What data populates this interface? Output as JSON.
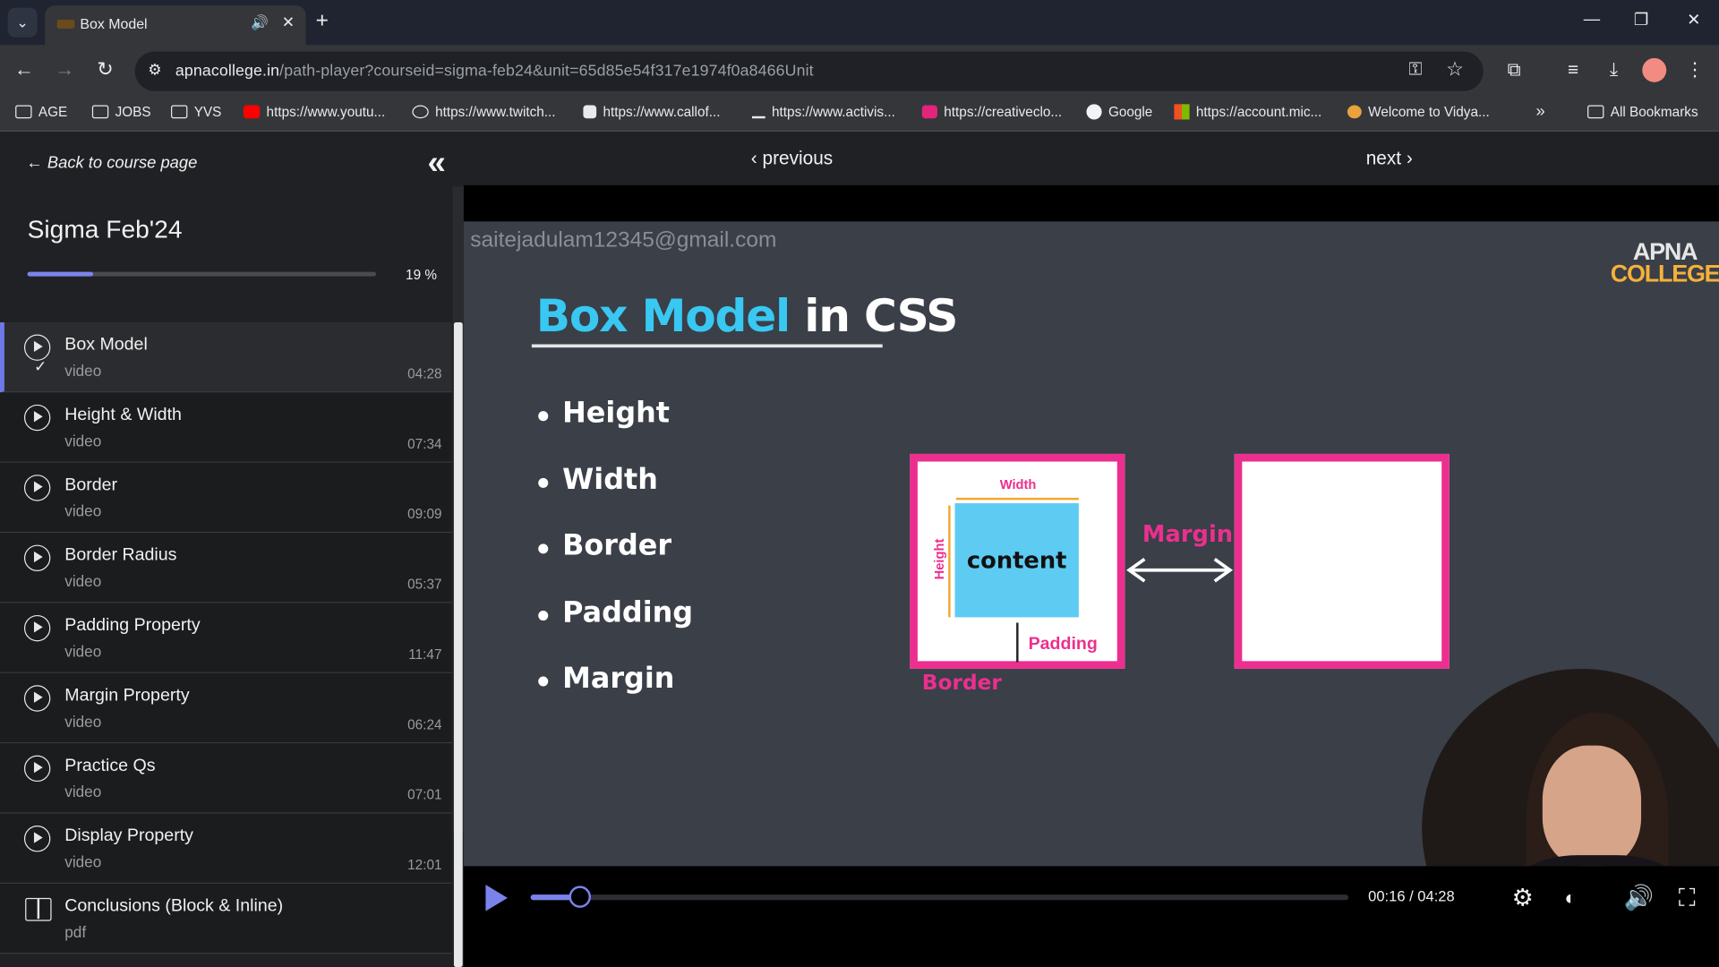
{
  "browser": {
    "tab_title": "Box Model",
    "url_host": "apnacollege.in",
    "url_path": "/path-player?courseid=sigma-feb24&unit=65d85e54f317e1974f0a8466Unit",
    "bookmarks": [
      {
        "label": "AGE",
        "icon": "folder-icon"
      },
      {
        "label": "JOBS",
        "icon": "folder-icon"
      },
      {
        "label": "YVS",
        "icon": "folder-icon"
      },
      {
        "label": "https://www.youtu...",
        "icon": "youtube-icon"
      },
      {
        "label": "https://www.twitch...",
        "icon": "globe-icon"
      },
      {
        "label": "https://www.callof...",
        "icon": "callofduty-icon"
      },
      {
        "label": "https://www.activis...",
        "icon": "activision-icon"
      },
      {
        "label": "https://creativeclo...",
        "icon": "creativecloud-icon"
      },
      {
        "label": "Google",
        "icon": "google-icon"
      },
      {
        "label": "https://account.mic...",
        "icon": "microsoft-icon"
      },
      {
        "label": "Welcome to Vidya...",
        "icon": "vidya-icon"
      }
    ],
    "more_bookmarks": "»",
    "all_bookmarks": "All Bookmarks"
  },
  "sidebar": {
    "back_label": "Back to course page",
    "course_title": "Sigma Feb'24",
    "progress_percent": 19,
    "progress_label": "19 %",
    "items": [
      {
        "name": "Box Model",
        "kind": "video",
        "duration": "04:28",
        "active": true,
        "completed": true
      },
      {
        "name": "Height & Width",
        "kind": "video",
        "duration": "07:34"
      },
      {
        "name": "Border",
        "kind": "video",
        "duration": "09:09"
      },
      {
        "name": "Border Radius",
        "kind": "video",
        "duration": "05:37"
      },
      {
        "name": "Padding Property",
        "kind": "video",
        "duration": "11:47"
      },
      {
        "name": "Margin Property",
        "kind": "video",
        "duration": "06:24"
      },
      {
        "name": "Practice Qs",
        "kind": "video",
        "duration": "07:01"
      },
      {
        "name": "Display Property",
        "kind": "video",
        "duration": "12:01"
      },
      {
        "name": "Conclusions (Block & Inline)",
        "kind": "pdf",
        "duration": ""
      }
    ]
  },
  "player": {
    "previous_label": "previous",
    "next_label": "next",
    "watermark": "saitejadulam12345@gmail.com",
    "brand_line1": "APNA",
    "brand_line2": "COLLEGE",
    "slide": {
      "title_part1": "Box Model",
      "title_part2": "in CSS",
      "bullets": [
        "Height",
        "Width",
        "Border",
        "Padding",
        "Margin"
      ],
      "diagram": {
        "content": "content",
        "width": "Width",
        "height": "Height",
        "padding": "Padding",
        "border": "Border",
        "margin": "Margin"
      }
    },
    "time_display": "00:16 / 04:28",
    "played_fraction": 0.06
  },
  "colors": {
    "accent": "#7b83eb",
    "slide_pink": "#ec2f8e",
    "slide_cyan": "#38c8f2"
  }
}
